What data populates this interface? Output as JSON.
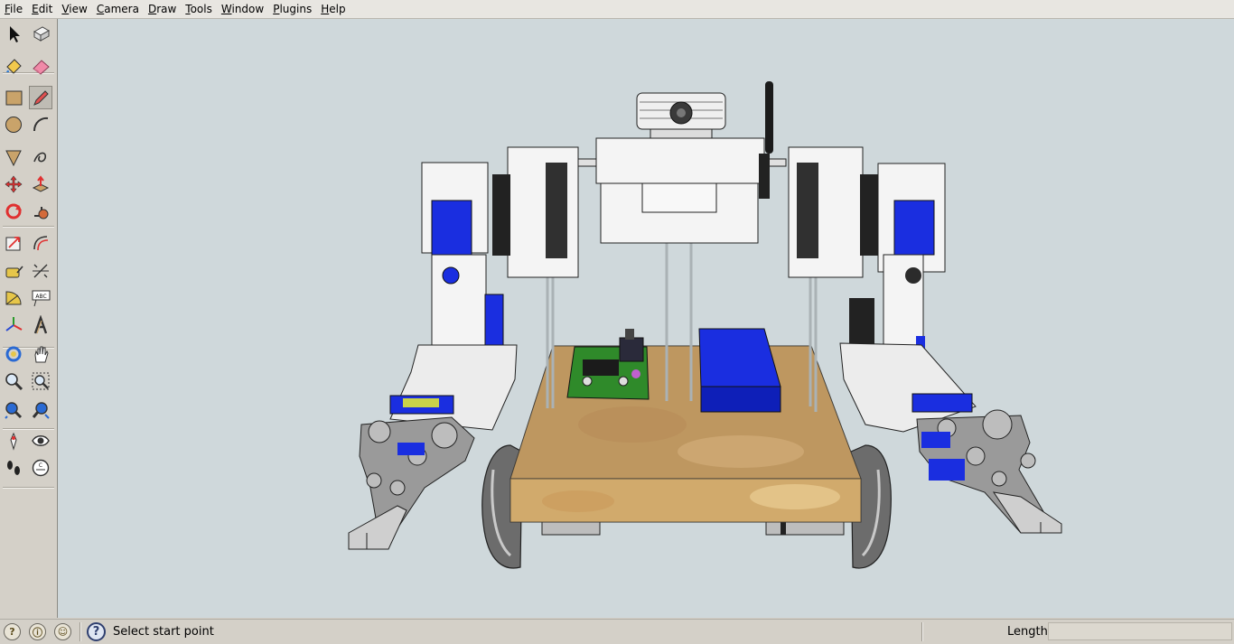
{
  "menubar": {
    "items": [
      {
        "label": "File",
        "underline": "F",
        "rest": "ile"
      },
      {
        "label": "Edit",
        "underline": "E",
        "rest": "dit"
      },
      {
        "label": "View",
        "underline": "V",
        "rest": "iew"
      },
      {
        "label": "Camera",
        "underline": "C",
        "rest": "amera"
      },
      {
        "label": "Draw",
        "underline": "D",
        "rest": "raw"
      },
      {
        "label": "Tools",
        "underline": "T",
        "rest": "ools"
      },
      {
        "label": "Window",
        "underline": "W",
        "rest": "indow"
      },
      {
        "label": "Plugins",
        "underline": "P",
        "rest": "lugins"
      },
      {
        "label": "Help",
        "underline": "H",
        "rest": "elp"
      }
    ]
  },
  "toolbar": {
    "tools": [
      {
        "name": "select-tool-icon"
      },
      {
        "name": "make-component-icon"
      },
      {
        "name": "paint-bucket-icon"
      },
      {
        "name": "eraser-icon"
      },
      {
        "name": "rectangle-icon"
      },
      {
        "name": "line-pencil-icon",
        "active": true
      },
      {
        "name": "circle-icon"
      },
      {
        "name": "arc-icon"
      },
      {
        "name": "polygon-icon"
      },
      {
        "name": "freehand-icon"
      },
      {
        "name": "move-icon"
      },
      {
        "name": "push-pull-icon"
      },
      {
        "name": "rotate-icon"
      },
      {
        "name": "follow-me-icon"
      },
      {
        "name": "scale-icon"
      },
      {
        "name": "offset-icon"
      },
      {
        "name": "tape-measure-icon"
      },
      {
        "name": "dimension-icon"
      },
      {
        "name": "protractor-icon"
      },
      {
        "name": "text-icon"
      },
      {
        "name": "axes-icon"
      },
      {
        "name": "3d-text-icon"
      },
      {
        "name": "orbit-icon"
      },
      {
        "name": "pan-icon"
      },
      {
        "name": "zoom-icon"
      },
      {
        "name": "zoom-window-icon"
      },
      {
        "name": "zoom-extents-icon"
      },
      {
        "name": "previous-view-icon"
      },
      {
        "name": "position-camera-icon"
      },
      {
        "name": "look-around-icon"
      },
      {
        "name": "walk-icon"
      },
      {
        "name": "section-plane-icon"
      }
    ],
    "text_tool_label": "ABC",
    "section_label": "C"
  },
  "viewport": {
    "background": "#cfd8db",
    "scene": "robot-model"
  },
  "statusbar": {
    "icons": [
      "geo-location-icon",
      "credits-icon",
      "sign-in-icon"
    ],
    "message": "Select start point",
    "vcb_label": "Length",
    "vcb_value": ""
  },
  "colors": {
    "accent_blue": "#1428d0",
    "wood": "#c9a36a",
    "chassis_white": "#f2f2f2"
  }
}
